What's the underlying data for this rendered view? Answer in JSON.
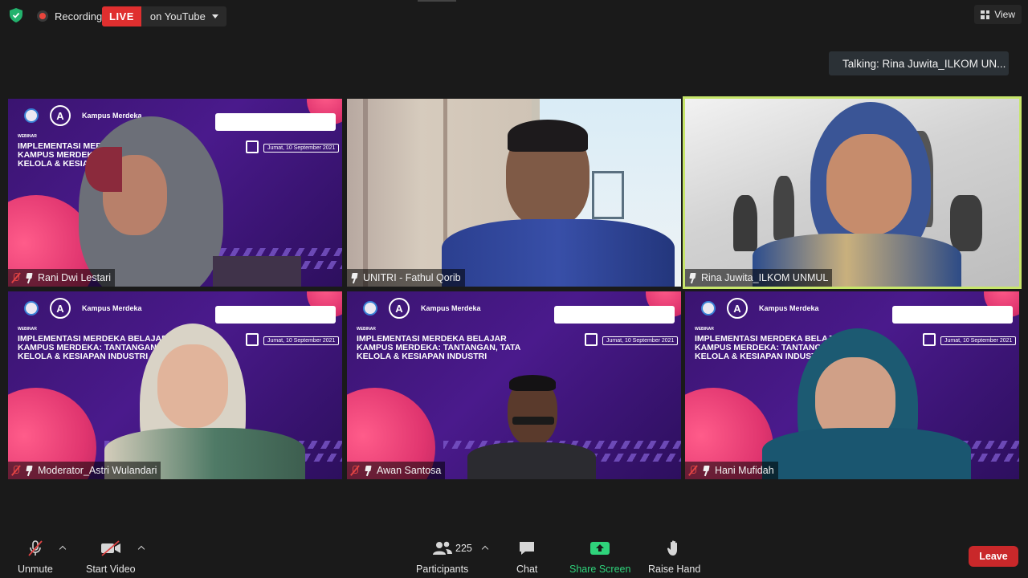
{
  "top": {
    "recording_label": "Recording",
    "live_badge": "LIVE",
    "live_target": "on YouTube",
    "view_label": "View",
    "talking_text": "Talking:  Rina  Juwita_ILKOM  UN..."
  },
  "banner": {
    "webinar_label": "WEBINAR",
    "headline": "Implementasi Merdeka Belajar Kampus Merdeka: Tantangan, Tata Kelola & Kesiapan Industri",
    "date": "Jumat, 10 September 2021",
    "logo_a": "A",
    "logo_k": "Kampus Merdeka"
  },
  "tiles": [
    {
      "name": "Rani Dwi Lestari",
      "muted": true,
      "bg": "banner"
    },
    {
      "name": "UNITRI - Fathul Qorib",
      "muted": false,
      "bg": "room"
    },
    {
      "name": "Rina Juwita_ILKOM UNMUL",
      "muted": false,
      "bg": "office",
      "active": true
    },
    {
      "name": "Moderator_Astri Wulandari",
      "muted": true,
      "bg": "banner"
    },
    {
      "name": "Awan Santosa",
      "muted": true,
      "bg": "banner"
    },
    {
      "name": "Hani Mufidah",
      "muted": true,
      "bg": "banner"
    }
  ],
  "toolbar": {
    "unmute": "Unmute",
    "start_video": "Start Video",
    "participants": "Participants",
    "participants_count": "225",
    "chat": "Chat",
    "share_screen": "Share Screen",
    "raise_hand": "Raise Hand",
    "leave": "Leave"
  },
  "colors": {
    "active_border": "#c7e66b",
    "live_red": "#e02f2f",
    "share_green": "#2fd37b",
    "leave_red": "#c9282a"
  }
}
